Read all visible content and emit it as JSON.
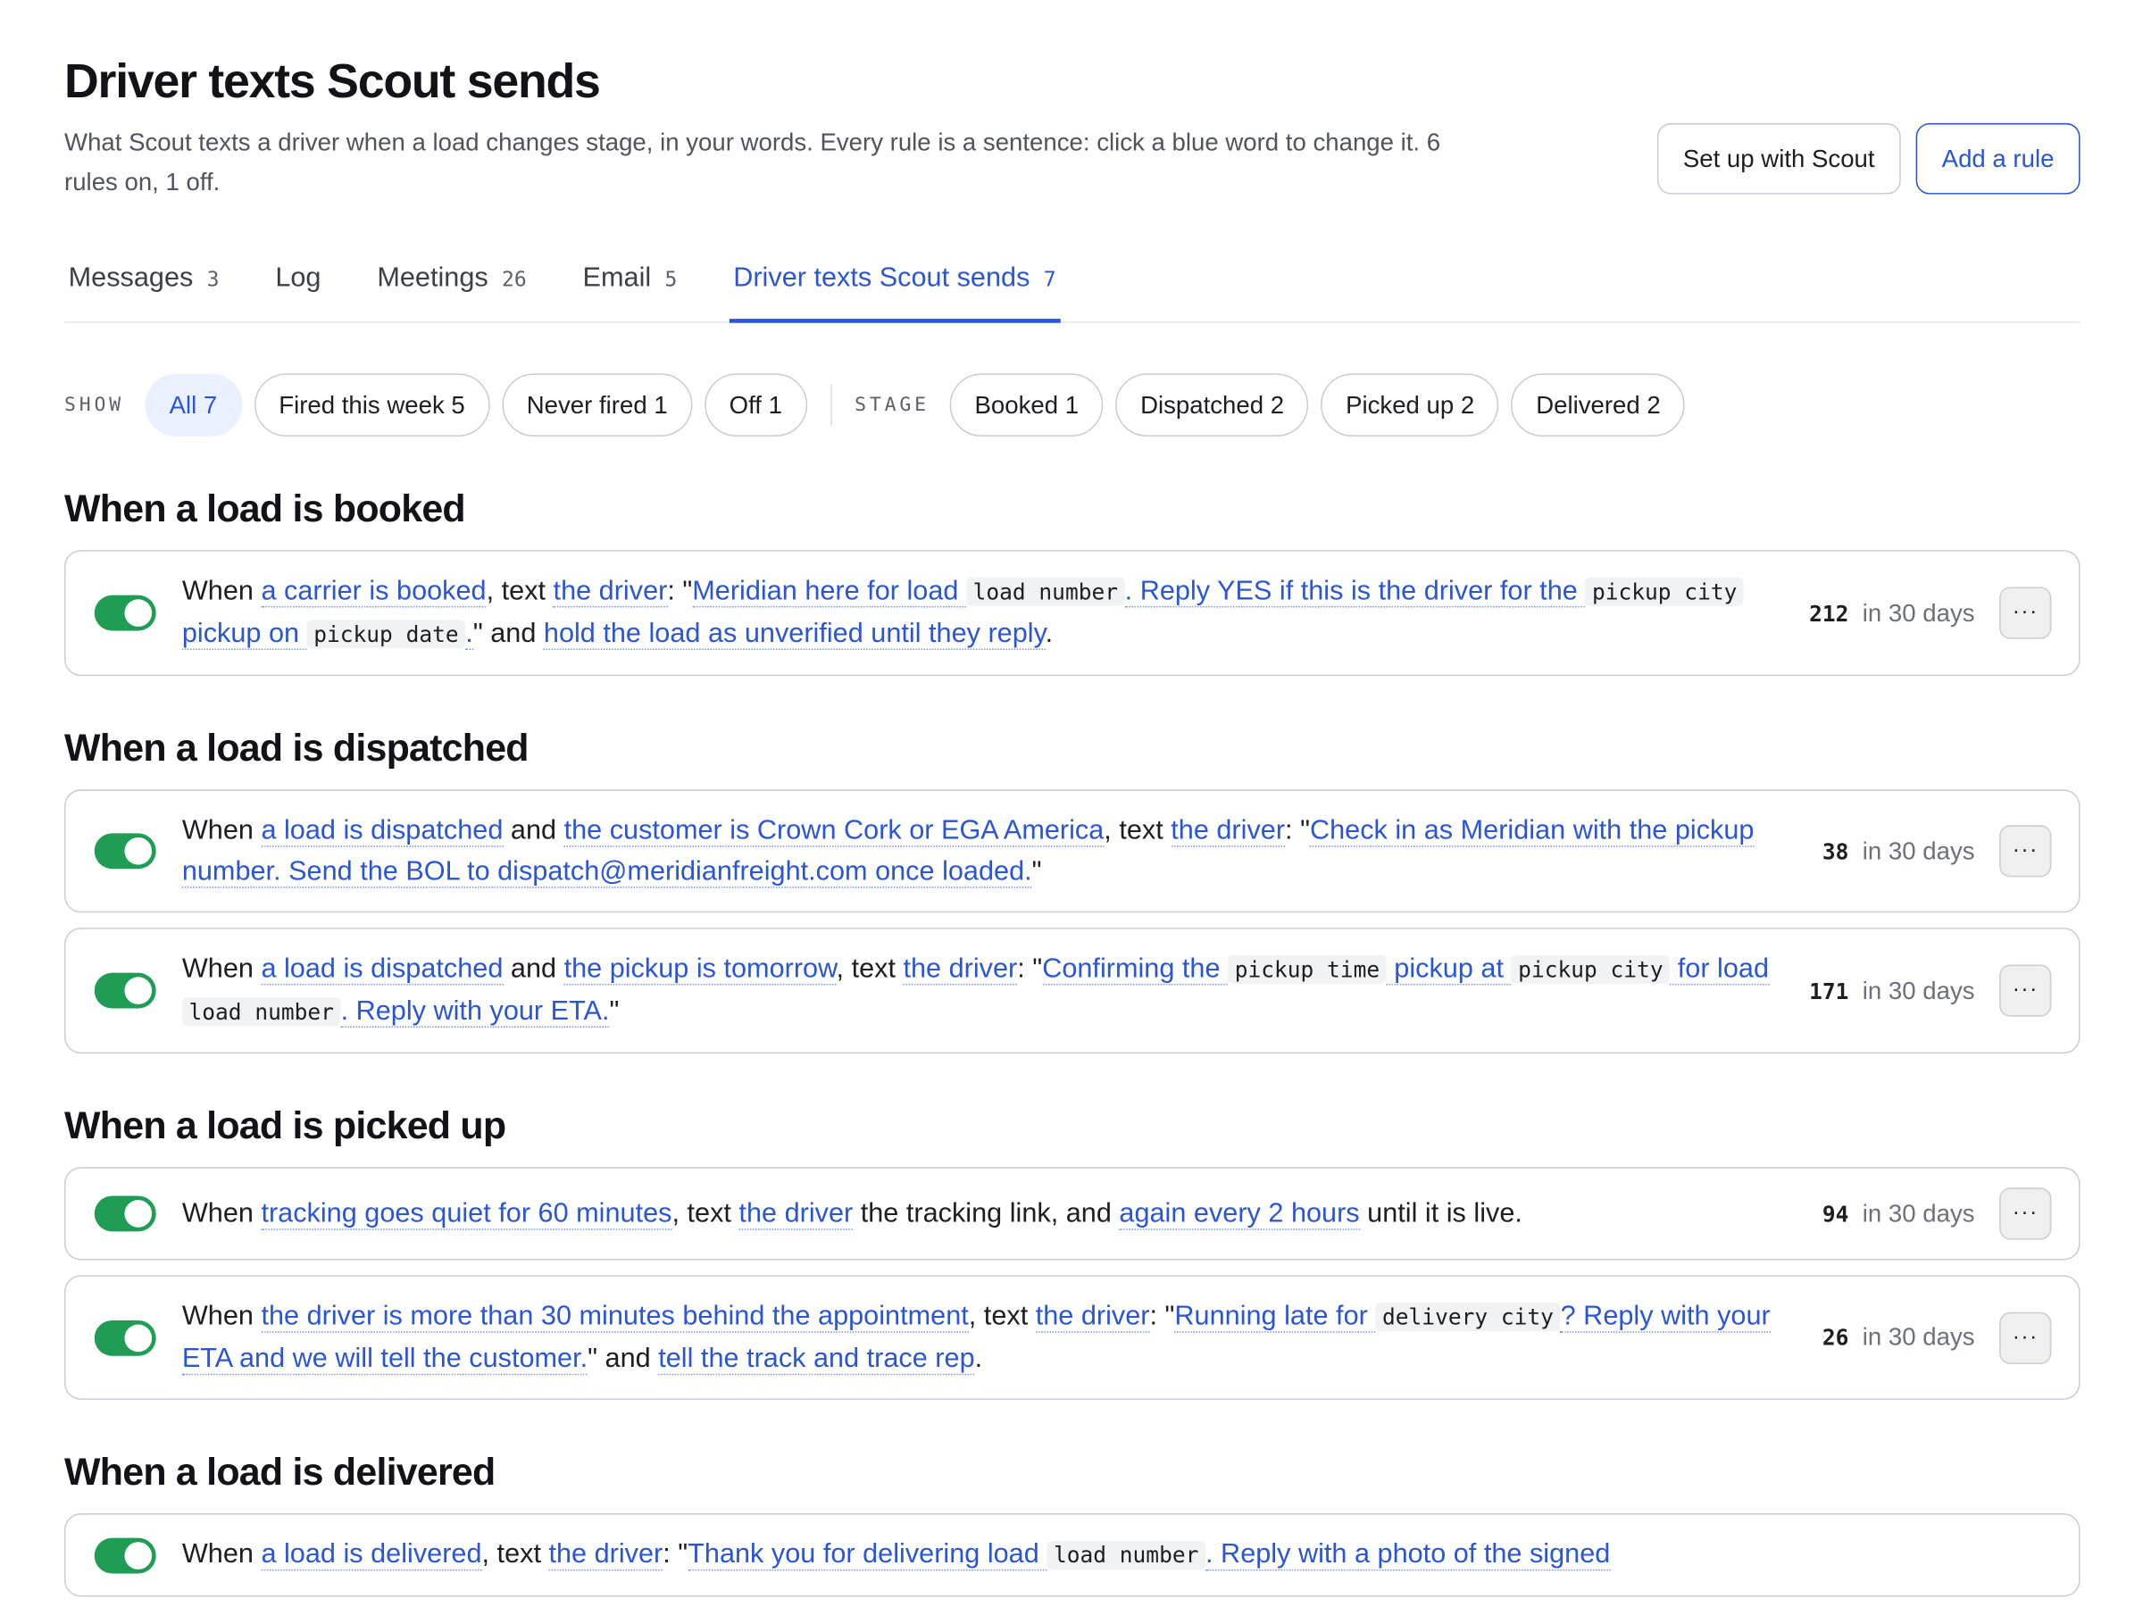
{
  "page": {
    "title": "Driver texts Scout sends",
    "subtitle": "What Scout texts a driver when a load changes stage, in your words. Every rule is a sentence: click a blue word to change it. 6 rules on, 1 off.",
    "setup_button": "Set up with Scout",
    "add_button": "Add a rule"
  },
  "tabs": [
    {
      "label": "Messages",
      "count": "3"
    },
    {
      "label": "Log",
      "count": ""
    },
    {
      "label": "Meetings",
      "count": "26"
    },
    {
      "label": "Email",
      "count": "5"
    },
    {
      "label": "Driver texts Scout sends",
      "count": "7"
    }
  ],
  "filters": {
    "show_label": "SHOW",
    "show": [
      "All 7",
      "Fired this week 5",
      "Never fired 1",
      "Off 1"
    ],
    "stage_label": "STAGE",
    "stage": [
      "Booked 1",
      "Dispatched 2",
      "Picked up 2",
      "Delivered 2"
    ]
  },
  "colors": {
    "accent": "#2a56d6",
    "toggle_on": "#1f9d55"
  },
  "sections": [
    {
      "title": "When a load is booked",
      "rules": [
        {
          "parts": [
            {
              "t": "When "
            },
            {
              "k": "tok",
              "t": "a carrier is booked"
            },
            {
              "t": ", text "
            },
            {
              "k": "tok",
              "t": "the driver"
            },
            {
              "t": ": \""
            },
            {
              "k": "tok",
              "t": "Meridian here for load "
            },
            {
              "k": "var",
              "t": "load number"
            },
            {
              "k": "tok",
              "t": ". Reply YES if this is the driver for the "
            },
            {
              "k": "var",
              "t": "pickup city"
            },
            {
              "k": "tok",
              "t": " pickup on "
            },
            {
              "k": "var",
              "t": "pickup date"
            },
            {
              "k": "tok",
              "t": "."
            },
            {
              "t": "\" and "
            },
            {
              "k": "tok",
              "t": "hold the load as unverified until they reply"
            },
            {
              "t": "."
            }
          ],
          "count": "212",
          "period": "in 30 days"
        }
      ]
    },
    {
      "title": "When a load is dispatched",
      "rules": [
        {
          "parts": [
            {
              "t": "When "
            },
            {
              "k": "tok",
              "t": "a load is dispatched"
            },
            {
              "t": " and "
            },
            {
              "k": "tok",
              "t": "the customer is Crown Cork or EGA America"
            },
            {
              "t": ", text "
            },
            {
              "k": "tok",
              "t": "the driver"
            },
            {
              "t": ": \""
            },
            {
              "k": "tok",
              "t": "Check in as Meridian with the pickup number. Send the BOL to dispatch@meridianfreight.com once loaded."
            },
            {
              "t": "\""
            }
          ],
          "count": "38",
          "period": "in 30 days"
        },
        {
          "parts": [
            {
              "t": "When "
            },
            {
              "k": "tok",
              "t": "a load is dispatched"
            },
            {
              "t": " and "
            },
            {
              "k": "tok",
              "t": "the pickup is tomorrow"
            },
            {
              "t": ", text "
            },
            {
              "k": "tok",
              "t": "the driver"
            },
            {
              "t": ": \""
            },
            {
              "k": "tok",
              "t": "Confirming the "
            },
            {
              "k": "var",
              "t": "pickup time"
            },
            {
              "k": "tok",
              "t": " pickup at "
            },
            {
              "k": "var",
              "t": "pickup city"
            },
            {
              "k": "tok",
              "t": " for load "
            },
            {
              "k": "var",
              "t": "load number"
            },
            {
              "k": "tok",
              "t": ". Reply with your ETA."
            },
            {
              "t": "\""
            }
          ],
          "count": "171",
          "period": "in 30 days"
        }
      ]
    },
    {
      "title": "When a load is picked up",
      "rules": [
        {
          "parts": [
            {
              "t": "When "
            },
            {
              "k": "tok",
              "t": "tracking goes quiet for 60 minutes"
            },
            {
              "t": ", text "
            },
            {
              "k": "tok",
              "t": "the driver"
            },
            {
              "t": " the tracking link, and "
            },
            {
              "k": "tok",
              "t": "again every 2 hours"
            },
            {
              "t": " until it is live."
            }
          ],
          "count": "94",
          "period": "in 30 days"
        },
        {
          "parts": [
            {
              "t": "When "
            },
            {
              "k": "tok",
              "t": "the driver is more than 30 minutes behind the appointment"
            },
            {
              "t": ", text "
            },
            {
              "k": "tok",
              "t": "the driver"
            },
            {
              "t": ": \""
            },
            {
              "k": "tok",
              "t": "Running late for "
            },
            {
              "k": "var",
              "t": "delivery city"
            },
            {
              "k": "tok",
              "t": "? Reply with your ETA and we will tell the customer."
            },
            {
              "t": "\" and "
            },
            {
              "k": "tok",
              "t": "tell the track and trace rep"
            },
            {
              "t": "."
            }
          ],
          "count": "26",
          "period": "in 30 days"
        }
      ]
    },
    {
      "title": "When a load is delivered",
      "rules": [
        {
          "parts": [
            {
              "t": "When "
            },
            {
              "k": "tok",
              "t": "a load is delivered"
            },
            {
              "t": ", text "
            },
            {
              "k": "tok",
              "t": "the driver"
            },
            {
              "t": ": \""
            },
            {
              "k": "tok",
              "t": "Thank you for delivering load "
            },
            {
              "k": "var",
              "t": "load number"
            },
            {
              "k": "tok",
              "t": ". Reply with a photo of the signed"
            }
          ],
          "count": "",
          "period": ""
        }
      ]
    }
  ]
}
